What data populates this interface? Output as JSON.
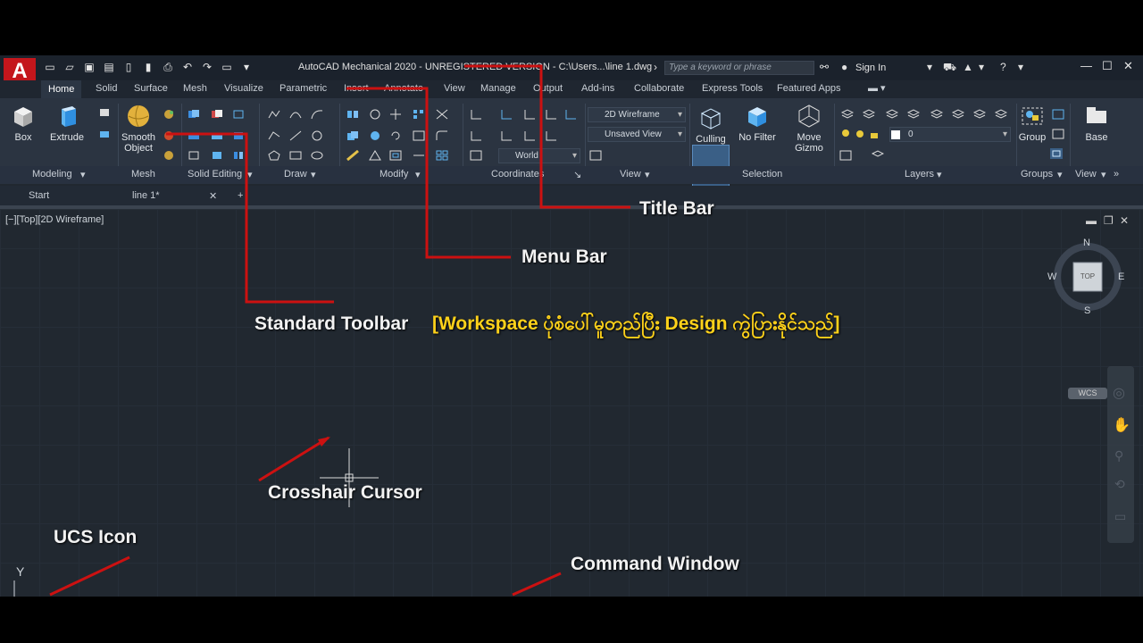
{
  "app": {
    "logo_letter": "A",
    "logo_badge": "M",
    "title": "AutoCAD Mechanical 2020 - UNREGISTERED VERSION - C:\\Users...\\line 1.dwg",
    "search_placeholder": "Type a keyword or phrase",
    "signin_label": "Sign In"
  },
  "ribbon_tabs": [
    "Home",
    "Solid",
    "Surface",
    "Mesh",
    "Visualize",
    "Parametric",
    "Insert",
    "Annotate",
    "View",
    "Manage",
    "Output",
    "Add-ins",
    "Collaborate",
    "Express Tools",
    "Featured Apps"
  ],
  "active_tab": "Home",
  "ribbon": {
    "buttons": {
      "box": "Box",
      "extrude": "Extrude",
      "smooth_object_line1": "Smooth",
      "smooth_object_line2": "Object",
      "culling": "Culling",
      "no_filter": "No Filter",
      "move_gizmo_line1": "Move",
      "move_gizmo_line2": "Gizmo",
      "group": "Group",
      "base": "Base"
    },
    "combos": {
      "visual_style": "2D Wireframe",
      "view": "Unsaved View",
      "ucs": "World",
      "layer": "0"
    },
    "groups": [
      "Modeling",
      "Mesh",
      "Solid Editing",
      "Draw",
      "Modify",
      "Coordinates",
      "View",
      "Selection",
      "Layers",
      "Groups",
      "View"
    ]
  },
  "file_tabs": {
    "start": "Start",
    "drawing": "line 1*"
  },
  "viewport": {
    "label": "[−][Top][2D Wireframe]",
    "viewcube": {
      "top": "TOP",
      "n": "N",
      "s": "S",
      "e": "E",
      "w": "W",
      "wcs": "WCS"
    },
    "ucs_y": "Y"
  },
  "annotations": {
    "title_bar": "Title Bar",
    "menu_bar": "Menu Bar",
    "standard_toolbar": "Standard Toolbar",
    "workspace_note": "[Workspace  ပုံစံပေါ်မူတည်ပြီး Design ကွဲပြားနိုင်သည်]",
    "crosshair": "Crosshair Cursor",
    "ucs_icon": "UCS Icon",
    "command_window": "Command Window"
  },
  "colors": {
    "annotation_line": "#cc1111",
    "annotation_note": "#ffd21a",
    "logo": "#c4161c"
  }
}
